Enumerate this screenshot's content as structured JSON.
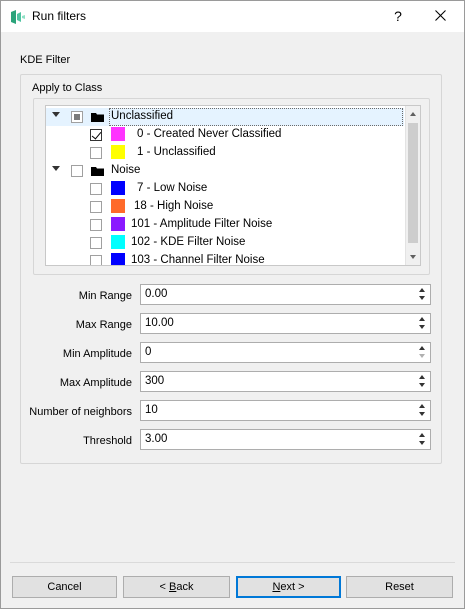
{
  "window": {
    "title": "Run filters",
    "help": "?"
  },
  "section_title": "KDE Filter",
  "apply_to_class_label": "Apply to Class",
  "tree": [
    {
      "label": "Unclassified",
      "type": "group",
      "check": "partial",
      "selected": true
    },
    {
      "label": "0 - Created Never Classified",
      "type": "item",
      "check": "checked",
      "color": "#ff33ff"
    },
    {
      "label": "1 - Unclassified",
      "type": "item",
      "check": "unchecked",
      "color": "#ffff00"
    },
    {
      "label": "Noise",
      "type": "group",
      "check": "unchecked"
    },
    {
      "label": "7 - Low Noise",
      "type": "item",
      "check": "unchecked",
      "color": "#0000ff"
    },
    {
      "label": "18 - High Noise",
      "type": "item",
      "check": "unchecked",
      "color": "#ff6a2a"
    },
    {
      "label": "101 - Amplitude Filter Noise",
      "type": "item",
      "check": "unchecked",
      "color": "#8a19ff"
    },
    {
      "label": "102 - KDE Filter Noise",
      "type": "item",
      "check": "unchecked",
      "color": "#00ffff"
    },
    {
      "label": "103 - Channel Filter Noise",
      "type": "item",
      "check": "unchecked",
      "color": "#0000ff"
    }
  ],
  "fields": [
    {
      "label": "Min Range",
      "value": "0.00"
    },
    {
      "label": "Max Range",
      "value": "10.00"
    },
    {
      "label": "Min Amplitude",
      "value": "0"
    },
    {
      "label": "Max Amplitude",
      "value": "300"
    },
    {
      "label": "Number of neighbors",
      "value": "10"
    },
    {
      "label": "Threshold",
      "value": "3.00"
    }
  ],
  "buttons": {
    "cancel": "Cancel",
    "back_prefix": "< ",
    "back_mnemonic": "B",
    "back_rest": "ack",
    "next_mnemonic": "N",
    "next_rest": "ext >",
    "reset": "Reset"
  }
}
